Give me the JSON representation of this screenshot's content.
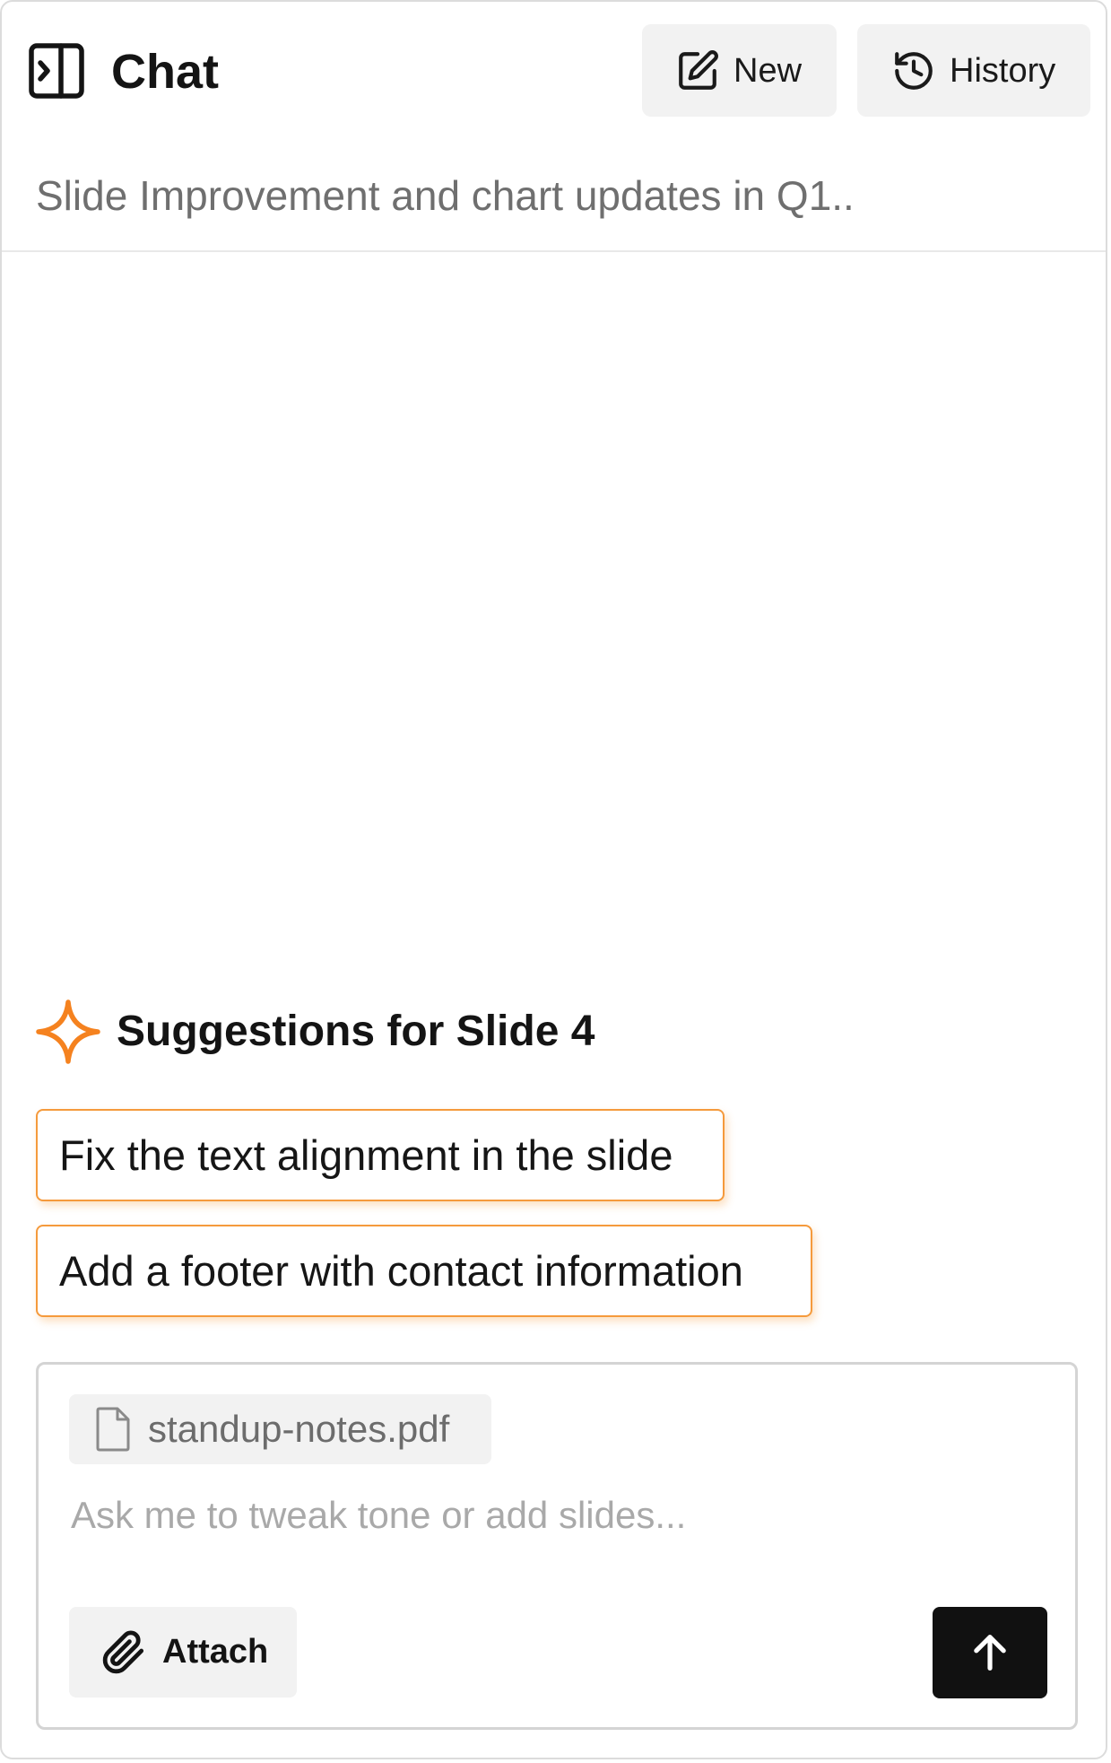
{
  "header": {
    "title": "Chat",
    "new_label": "New",
    "history_label": "History",
    "icons": {
      "toggle": "sidebar-expand-icon",
      "new": "edit-icon",
      "history": "history-icon"
    }
  },
  "conversation": {
    "title": "Slide Improvement and chart updates in Q1.."
  },
  "suggestions": {
    "heading": "Suggestions for Slide 4",
    "icon": "sparkle-icon",
    "accent_color": "#f5821f",
    "items": [
      "Fix the text alignment in the slide",
      "Add a footer with contact information"
    ]
  },
  "composer": {
    "attachment": {
      "file_name": "standup-notes.pdf",
      "icon": "file-icon"
    },
    "placeholder": "Ask me to tweak tone or add slides...",
    "attach_label": "Attach",
    "attach_icon": "paperclip-icon",
    "send_icon": "arrow-up-icon"
  }
}
